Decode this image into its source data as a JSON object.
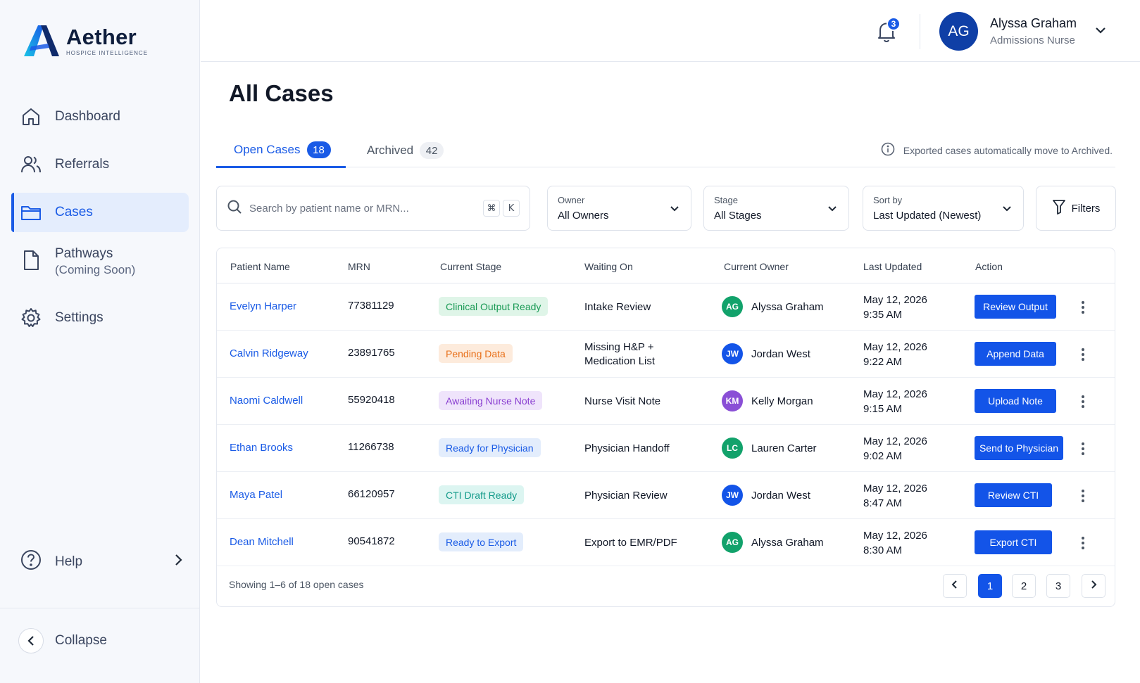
{
  "brand": {
    "name": "Aether",
    "tagline": "HOSPICE INTELLIGENCE"
  },
  "sidebar": {
    "items": [
      {
        "label": "Dashboard",
        "icon": "home-icon"
      },
      {
        "label": "Referrals",
        "icon": "users-icon"
      },
      {
        "label": "Cases",
        "icon": "folder-icon",
        "active": true
      },
      {
        "label": "Pathways",
        "sublabel": "(Coming Soon)",
        "icon": "file-icon"
      },
      {
        "label": "Settings",
        "icon": "gear-icon"
      }
    ],
    "help_label": "Help",
    "collapse_label": "Collapse"
  },
  "header": {
    "notification_count": "3",
    "user": {
      "initials": "AG",
      "name": "Alyssa Graham",
      "role": "Admissions Nurse"
    }
  },
  "page": {
    "title": "All Cases"
  },
  "tabs": {
    "open": {
      "label": "Open Cases",
      "count": "18"
    },
    "archived": {
      "label": "Archived",
      "count": "42"
    },
    "note": "Exported cases automatically move to Archived."
  },
  "filters": {
    "search_placeholder": "Search by patient name or MRN...",
    "shortcut": [
      "⌘",
      "K"
    ],
    "owner": {
      "label": "Owner",
      "value": "All Owners"
    },
    "stage": {
      "label": "Stage",
      "value": "All Stages"
    },
    "sort": {
      "label": "Sort by",
      "value": "Last Updated (Newest)"
    },
    "filters_label": "Filters"
  },
  "table": {
    "columns": [
      "Patient Name",
      "MRN",
      "Current Stage",
      "Waiting On",
      "Current Owner",
      "Last Updated",
      "Action"
    ],
    "rows": [
      {
        "name": "Evelyn Harper",
        "mrn": "77381129",
        "stage": "Clinical Output Ready",
        "stage_bg": "#dff5e8",
        "stage_fg": "#1a9a55",
        "waiting": [
          "Intake Review"
        ],
        "owner_initials": "AG",
        "owner_color": "#12a26b",
        "owner": "Alyssa Graham",
        "date": "May 12, 2026",
        "time": "9:35 AM",
        "action": "Review Output"
      },
      {
        "name": "Calvin Ridgeway",
        "mrn": "23891765",
        "stage": "Pending Data",
        "stage_bg": "#fdebdc",
        "stage_fg": "#e8701a",
        "waiting": [
          "Missing H&P +",
          "Medication List"
        ],
        "owner_initials": "JW",
        "owner_color": "#1354e8",
        "owner": "Jordan West",
        "date": "May 12, 2026",
        "time": "9:22 AM",
        "action": "Append Data"
      },
      {
        "name": "Naomi Caldwell",
        "mrn": "55920418",
        "stage": "Awaiting Nurse Note",
        "stage_bg": "#efe4fb",
        "stage_fg": "#8a3fd1",
        "waiting": [
          "Nurse Visit Note"
        ],
        "owner_initials": "KM",
        "owner_color": "#8a4fd6",
        "owner": "Kelly Morgan",
        "date": "May 12, 2026",
        "time": "9:15 AM",
        "action": "Upload Note"
      },
      {
        "name": "Ethan Brooks",
        "mrn": "11266738",
        "stage": "Ready for Physician",
        "stage_bg": "#e3edfc",
        "stage_fg": "#1a5be6",
        "waiting": [
          "Physician Handoff"
        ],
        "owner_initials": "LC",
        "owner_color": "#12a26b",
        "owner": "Lauren Carter",
        "date": "May 12, 2026",
        "time": "9:02 AM",
        "action": "Send to Physician"
      },
      {
        "name": "Maya Patel",
        "mrn": "66120957",
        "stage": "CTI Draft Ready",
        "stage_bg": "#dcf5f1",
        "stage_fg": "#139b8a",
        "waiting": [
          "Physician Review"
        ],
        "owner_initials": "JW",
        "owner_color": "#1354e8",
        "owner": "Jordan West",
        "date": "May 12, 2026",
        "time": "8:47 AM",
        "action": "Review CTI"
      },
      {
        "name": "Dean Mitchell",
        "mrn": "90541872",
        "stage": "Ready to Export",
        "stage_bg": "#e3edfc",
        "stage_fg": "#1a5be6",
        "waiting": [
          "Export to EMR/PDF"
        ],
        "owner_initials": "AG",
        "owner_color": "#12a26b",
        "owner": "Alyssa Graham",
        "date": "May 12, 2026",
        "time": "8:30 AM",
        "action": "Export CTI"
      }
    ],
    "footer_text": "Showing 1–6 of 18 open cases",
    "pages": [
      "1",
      "2",
      "3"
    ],
    "current_page": "1"
  },
  "colors": {
    "accent": "#1a5be6",
    "button": "#1354e8",
    "sidebar_bg": "#f6f8fc",
    "active_bg": "#e4edfd"
  }
}
